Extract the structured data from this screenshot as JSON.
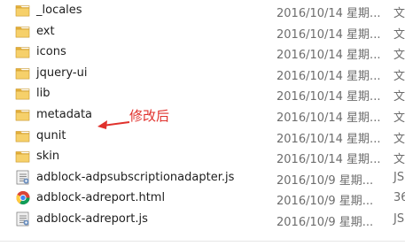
{
  "files": [
    {
      "icon": "folder-icon",
      "name": "_locales",
      "date": "2016/10/14 星期...",
      "type": "文"
    },
    {
      "icon": "folder-icon",
      "name": "ext",
      "date": "2016/10/14 星期...",
      "type": "文"
    },
    {
      "icon": "folder-icon",
      "name": "icons",
      "date": "2016/10/14 星期...",
      "type": "文"
    },
    {
      "icon": "folder-icon",
      "name": "jquery-ui",
      "date": "2016/10/14 星期...",
      "type": "文"
    },
    {
      "icon": "folder-icon",
      "name": "lib",
      "date": "2016/10/14 星期...",
      "type": "文"
    },
    {
      "icon": "folder-icon",
      "name": "metadata",
      "date": "2016/10/14 星期...",
      "type": "文"
    },
    {
      "icon": "folder-icon",
      "name": "qunit",
      "date": "2016/10/14 星期...",
      "type": "文"
    },
    {
      "icon": "folder-icon",
      "name": "skin",
      "date": "2016/10/14 星期...",
      "type": "文"
    },
    {
      "icon": "js-file-icon",
      "name": "adblock-adpsubscriptionadapter.js",
      "date": "2016/10/9 星期...",
      "type": "JS"
    },
    {
      "icon": "html-file-icon",
      "name": "adblock-adreport.html",
      "date": "2016/10/9 星期...",
      "type": "36"
    },
    {
      "icon": "js-file-icon",
      "name": "adblock-adreport.js",
      "date": "2016/10/9 星期...",
      "type": "JS"
    }
  ],
  "annotation": {
    "text": "修改后",
    "color": "#e0312c"
  }
}
